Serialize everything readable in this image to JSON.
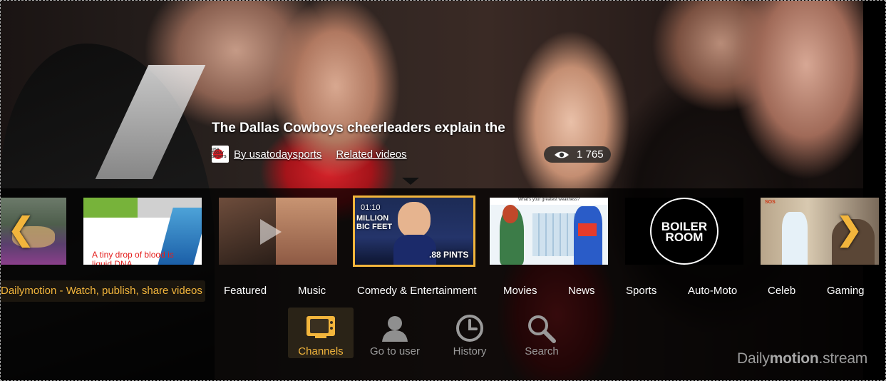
{
  "video": {
    "title": "The Dallas Cowboys cheerleaders explain the",
    "channel_link": "By usatodaysports",
    "related_link": "Related videos",
    "views": "1 765",
    "channel_logo_text": "USA TODAY SPORTS"
  },
  "strip": {
    "prev_arrow": "❮",
    "next_arrow": "❯",
    "thumbs": [
      {
        "id": "t0",
        "caption": ""
      },
      {
        "id": "t1",
        "caption": "A tiny drop of blood is liquid DNA"
      },
      {
        "id": "t2",
        "caption": ""
      },
      {
        "id": "t3",
        "duration": "01:10",
        "overlay_top": "MILLION",
        "overlay_mid": "BIC FEET",
        "overlay_bottom": ".88 PINTS"
      },
      {
        "id": "t4",
        "caption": "What's your greatest weakness?"
      },
      {
        "id": "t5",
        "caption": "BOILER ROOM"
      },
      {
        "id": "t6",
        "caption": "SOS"
      }
    ]
  },
  "categories": [
    {
      "label": "Dailymotion - Watch, publish, share videos",
      "active": true
    },
    {
      "label": "Featured"
    },
    {
      "label": "Music"
    },
    {
      "label": "Comedy & Entertainment"
    },
    {
      "label": "Movies"
    },
    {
      "label": "News"
    },
    {
      "label": "Sports"
    },
    {
      "label": "Auto-Moto"
    },
    {
      "label": "Celeb"
    },
    {
      "label": "Gaming"
    }
  ],
  "nav": {
    "channels": "Channels",
    "go_to_user": "Go to user",
    "history": "History",
    "search": "Search"
  },
  "brand": {
    "prefix": "Daily",
    "bold": "motion",
    "suffix": ".stream"
  },
  "colors": {
    "accent": "#f2b53c",
    "muted": "#9a9a9a"
  }
}
